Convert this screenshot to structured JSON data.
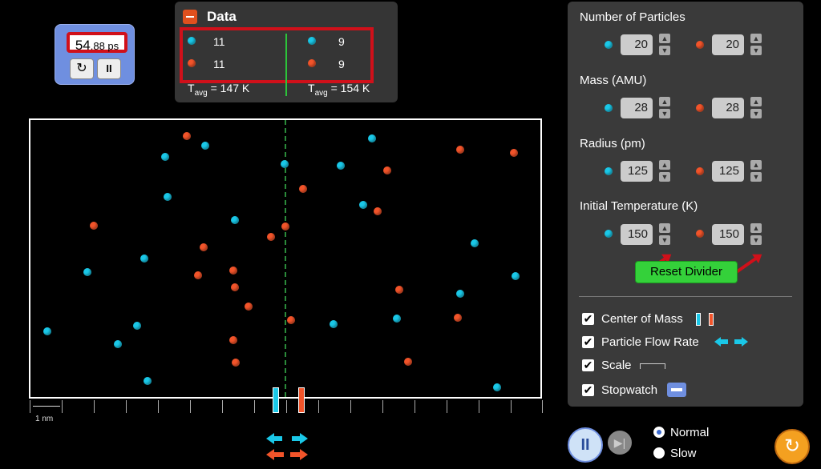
{
  "stopwatch": {
    "big": "54",
    "small": ".88 ps",
    "reset_icon": "↻",
    "pause_icon": "II"
  },
  "data_panel": {
    "title": "Data",
    "left_cyan": "11",
    "left_orange": "11",
    "right_cyan": "9",
    "right_orange": "9",
    "left_tavg": "147 K",
    "right_tavg": "154 K",
    "tavg_label": "T",
    "tavg_sub": "avg"
  },
  "scale_label": "1 nm",
  "controls": {
    "num_particles": {
      "label": "Number of Particles",
      "cyan": "20",
      "orange": "20"
    },
    "mass": {
      "label": "Mass (AMU)",
      "cyan": "28",
      "orange": "28"
    },
    "radius": {
      "label": "Radius (pm)",
      "cyan": "125",
      "orange": "125"
    },
    "initial_temp": {
      "label": "Initial Temperature (K)",
      "cyan": "150",
      "orange": "150"
    },
    "reset_divider": "Reset Divider",
    "checkboxes": [
      {
        "label": "Center of Mass",
        "checked": true
      },
      {
        "label": "Particle Flow Rate",
        "checked": true
      },
      {
        "label": "Scale",
        "checked": true
      },
      {
        "label": "Stopwatch",
        "checked": true
      }
    ]
  },
  "speed": {
    "normal": "Normal",
    "slow": "Slow",
    "selected": "Normal"
  },
  "icons": {
    "pause": "pause-icon",
    "step": "step-forward-icon",
    "reset": "reset-all-icon"
  },
  "colors": {
    "cyan": "#1ac8e8",
    "orange": "#f2542a",
    "divider": "#2a8a3a",
    "highlight": "#d0101a",
    "reset_divider": "#34d13a"
  }
}
